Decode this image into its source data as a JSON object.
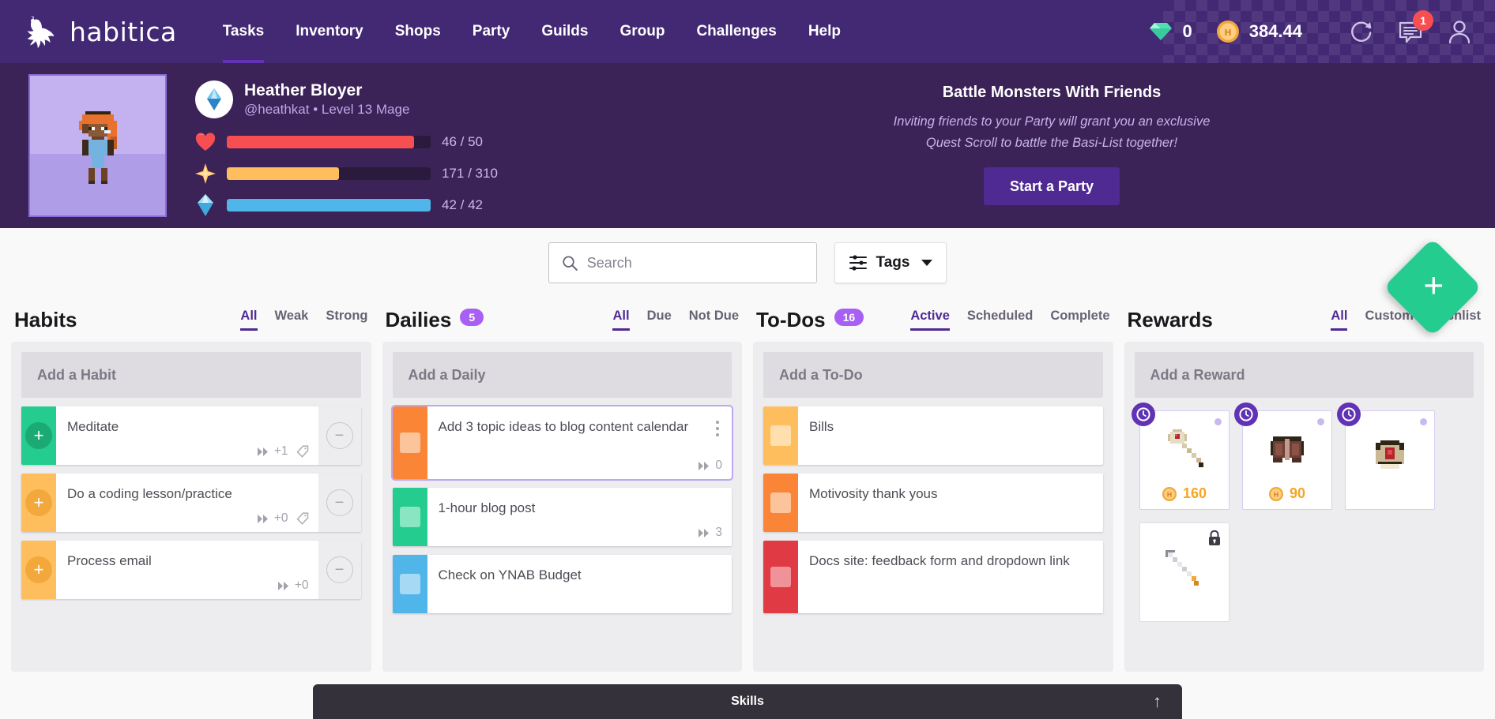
{
  "header": {
    "brand": "habitica",
    "nav": [
      {
        "label": "Tasks",
        "active": true
      },
      {
        "label": "Inventory",
        "active": false
      },
      {
        "label": "Shops",
        "active": false
      },
      {
        "label": "Party",
        "active": false
      },
      {
        "label": "Guilds",
        "active": false
      },
      {
        "label": "Group",
        "active": false
      },
      {
        "label": "Challenges",
        "active": false
      },
      {
        "label": "Help",
        "active": false
      }
    ],
    "gems": "0",
    "gold": "384.44",
    "notification_count": "1"
  },
  "profile": {
    "display_name": "Heather Bloyer",
    "subtitle": "@heathkat • Level 13 Mage",
    "stats": [
      {
        "name": "health",
        "text": "46 / 50",
        "percent": 92,
        "color": "#f74e52"
      },
      {
        "name": "experience",
        "text": "171 / 310",
        "percent": 55,
        "color": "#ffbe5d"
      },
      {
        "name": "mana",
        "text": "42 / 42",
        "percent": 100,
        "color": "#50b5e9"
      }
    ]
  },
  "party_promo": {
    "title": "Battle Monsters With Friends",
    "line1": "Inviting friends to your Party will grant you an exclusive",
    "line2": "Quest Scroll to battle the Basi-List together!",
    "button": "Start a Party"
  },
  "fab": {
    "label": "+"
  },
  "search": {
    "placeholder": "Search",
    "value": ""
  },
  "tags": {
    "label": "Tags"
  },
  "columns": [
    {
      "key": "habits",
      "title": "Habits",
      "count": null,
      "filters": [
        {
          "label": "All",
          "active": true
        },
        {
          "label": "Weak",
          "active": false
        },
        {
          "label": "Strong",
          "active": false
        }
      ],
      "add_label": "Add a Habit",
      "type": "habit",
      "tasks": [
        {
          "title": "Meditate",
          "color": "#24cc8f",
          "btn_color": "#1ba974",
          "streak": "+1",
          "has_tag": true,
          "has_minus": true
        },
        {
          "title": "Do a coding lesson/practice",
          "color": "#ffbe5d",
          "btn_color": "#f2a83a",
          "streak": "+0",
          "has_tag": true,
          "has_minus": true
        },
        {
          "title": "Process email",
          "color": "#ffbe5d",
          "btn_color": "#f2a83a",
          "streak": "+0",
          "has_tag": false,
          "has_minus": true
        }
      ]
    },
    {
      "key": "dailies",
      "title": "Dailies",
      "count": "5",
      "filters": [
        {
          "label": "All",
          "active": true
        },
        {
          "label": "Due",
          "active": false
        },
        {
          "label": "Not Due",
          "active": false
        }
      ],
      "add_label": "Add a Daily",
      "type": "daily",
      "tasks": [
        {
          "title": "Add 3 topic ideas to blog content calendar",
          "color": "#fa8537",
          "box_color": "#fcc49b",
          "streak": "0",
          "selected": true,
          "has_kebab": true
        },
        {
          "title": "1-hour blog post",
          "color": "#24cc8f",
          "box_color": "#8ae6c2",
          "streak": "3",
          "selected": false,
          "has_kebab": false
        },
        {
          "title": "Check on YNAB Budget",
          "color": "#50b5e9",
          "box_color": "#a6daf4",
          "streak": "",
          "selected": false,
          "has_kebab": false
        }
      ]
    },
    {
      "key": "todos",
      "title": "To-Dos",
      "count": "16",
      "filters": [
        {
          "label": "Active",
          "active": true
        },
        {
          "label": "Scheduled",
          "active": false
        },
        {
          "label": "Complete",
          "active": false
        }
      ],
      "add_label": "Add a To-Do",
      "type": "todo",
      "tasks": [
        {
          "title": "Bills",
          "color": "#ffbe5d",
          "box_color": "#ffdfae",
          "streak": "",
          "selected": false,
          "has_kebab": false
        },
        {
          "title": "Motivosity thank yous",
          "color": "#fa8537",
          "box_color": "#fcc49b",
          "streak": "",
          "selected": false,
          "has_kebab": false
        },
        {
          "title": "Docs site: feedback form and dropdown link",
          "color": "#e03b45",
          "box_color": "#ef9398",
          "streak": "",
          "selected": false,
          "has_kebab": false
        }
      ]
    },
    {
      "key": "rewards",
      "title": "Rewards",
      "count": null,
      "filters": [
        {
          "label": "All",
          "active": true
        },
        {
          "label": "Custom",
          "active": false
        },
        {
          "label": "Wishlist",
          "active": false
        }
      ],
      "add_label": "Add a Reward",
      "type": "reward",
      "rewards": [
        {
          "name": "mace-weapon",
          "price": "160",
          "locked": false,
          "has_clock": true,
          "has_dot": true,
          "art": "mace"
        },
        {
          "name": "armor-piece",
          "price": "90",
          "locked": false,
          "has_clock": true,
          "has_dot": true,
          "art": "armor"
        },
        {
          "name": "helm-piece",
          "price": "",
          "locked": false,
          "has_clock": true,
          "has_dot": true,
          "art": "helm"
        },
        {
          "name": "locked-sword",
          "price": "",
          "locked": true,
          "has_clock": false,
          "has_dot": false,
          "art": "sword"
        }
      ]
    }
  ],
  "skills": {
    "label": "Skills"
  }
}
